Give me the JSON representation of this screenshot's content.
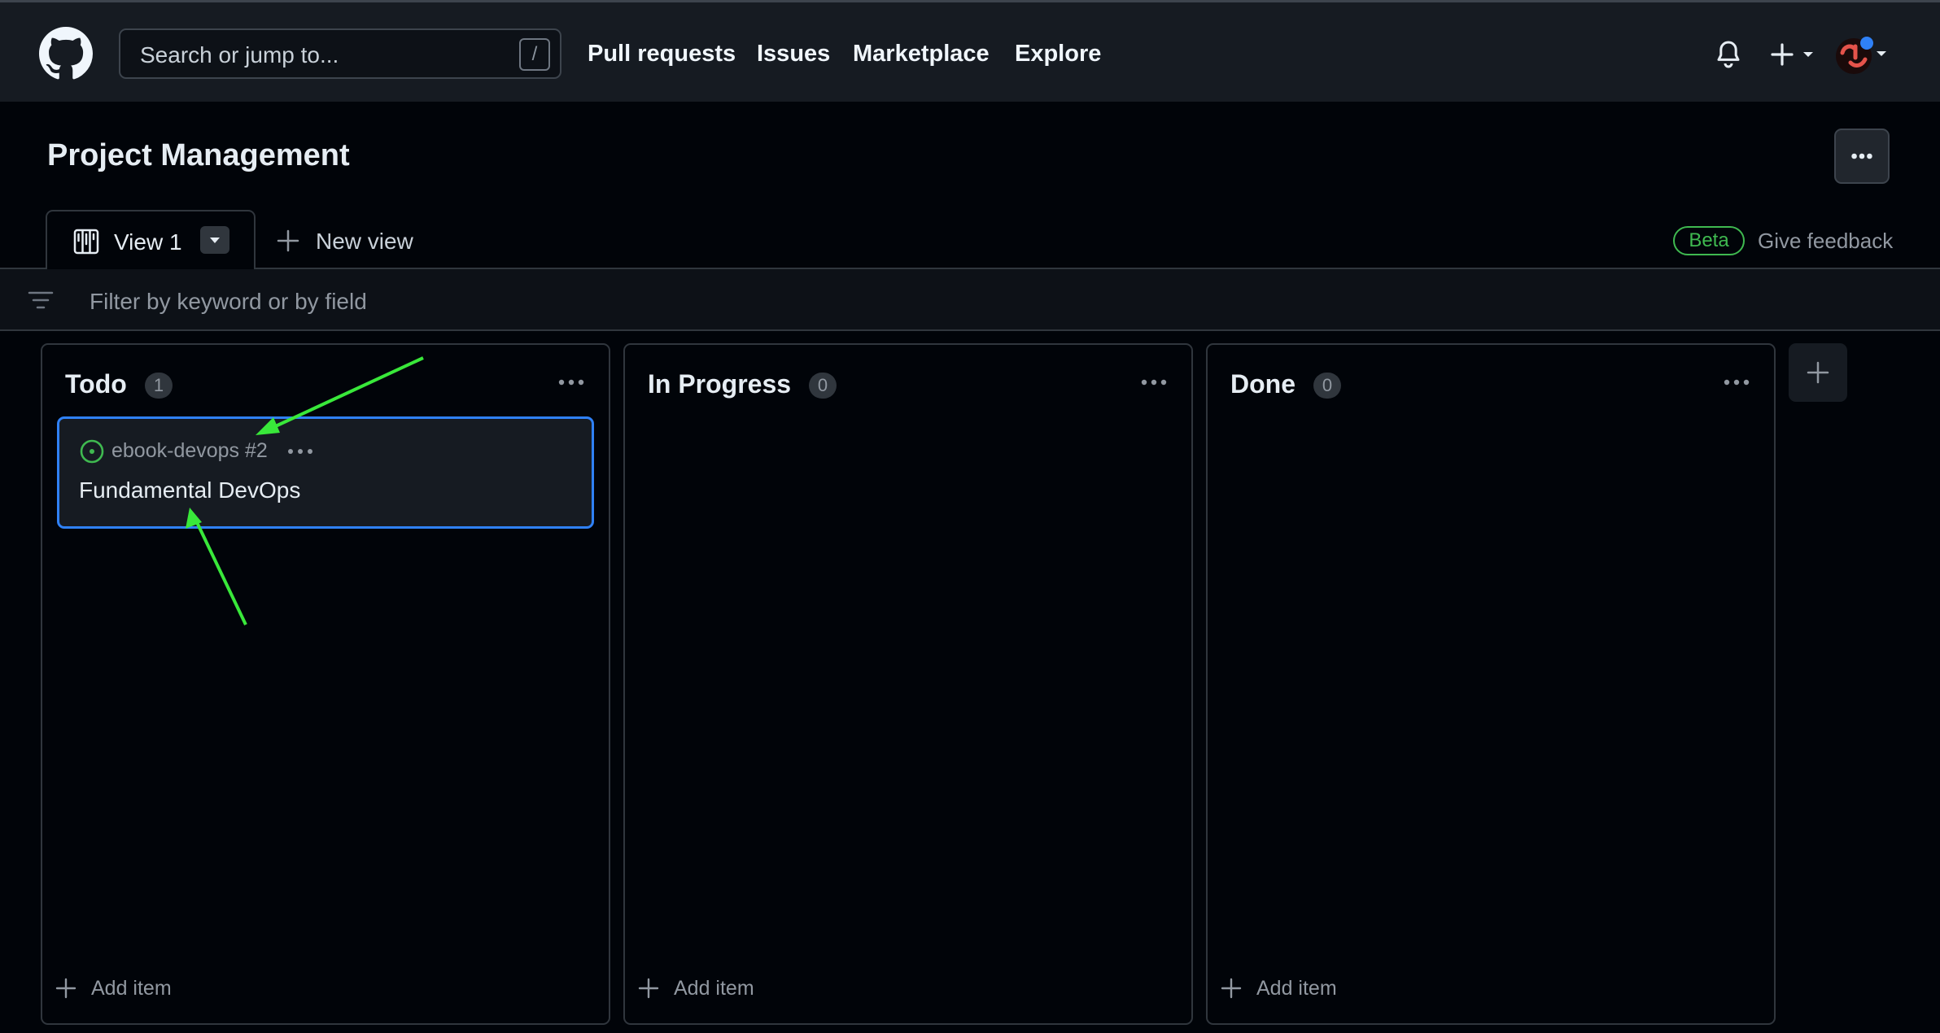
{
  "header": {
    "search_placeholder": "Search or jump to...",
    "search_shortcut": "/",
    "nav": [
      "Pull requests",
      "Issues",
      "Marketplace",
      "Explore"
    ]
  },
  "project": {
    "title": "Project Management",
    "active_tab": "View 1",
    "new_view_label": "New view",
    "beta_label": "Beta",
    "feedback_label": "Give feedback",
    "filter_placeholder": "Filter by keyword or by field"
  },
  "columns": [
    {
      "title": "Todo",
      "count": "1",
      "add_item_label": "Add item",
      "cards": [
        {
          "repo": "ebook-devops #2",
          "title": "Fundamental DevOps",
          "status": "open"
        }
      ]
    },
    {
      "title": "In Progress",
      "count": "0",
      "add_item_label": "Add item",
      "cards": []
    },
    {
      "title": "Done",
      "count": "0",
      "add_item_label": "Add item",
      "cards": []
    }
  ],
  "colors": {
    "accent_blue": "#2f81f7",
    "open_green": "#3fb950",
    "annotation_arrow": "#39e83a"
  },
  "icons": [
    "github-logo-icon",
    "bell-icon",
    "plus-icon",
    "board-icon",
    "filter-icon",
    "issue-open-icon",
    "kebab-icon"
  ]
}
